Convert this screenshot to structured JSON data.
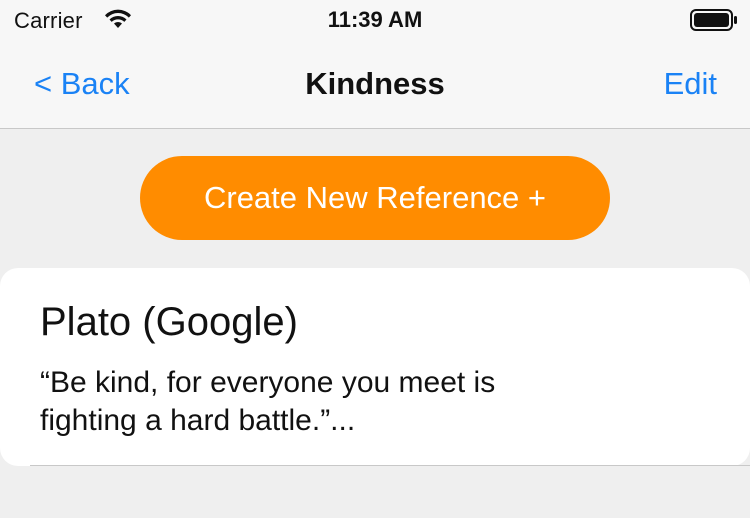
{
  "status_bar": {
    "carrier": "Carrier",
    "time": "11:39 AM",
    "wifi_icon": "wifi-icon",
    "battery_icon": "battery-icon"
  },
  "nav": {
    "back_label": "< Back",
    "title": "Kindness",
    "edit_label": "Edit"
  },
  "actions": {
    "create_label": "Create New Reference +",
    "create_color": "#ff8c00"
  },
  "references": [
    {
      "title": "Plato (Google)",
      "quote": "“Be kind, for everyone you meet is fighting a hard battle.”..."
    }
  ],
  "colors": {
    "accent": "#1a82f5",
    "background": "#efefef"
  }
}
